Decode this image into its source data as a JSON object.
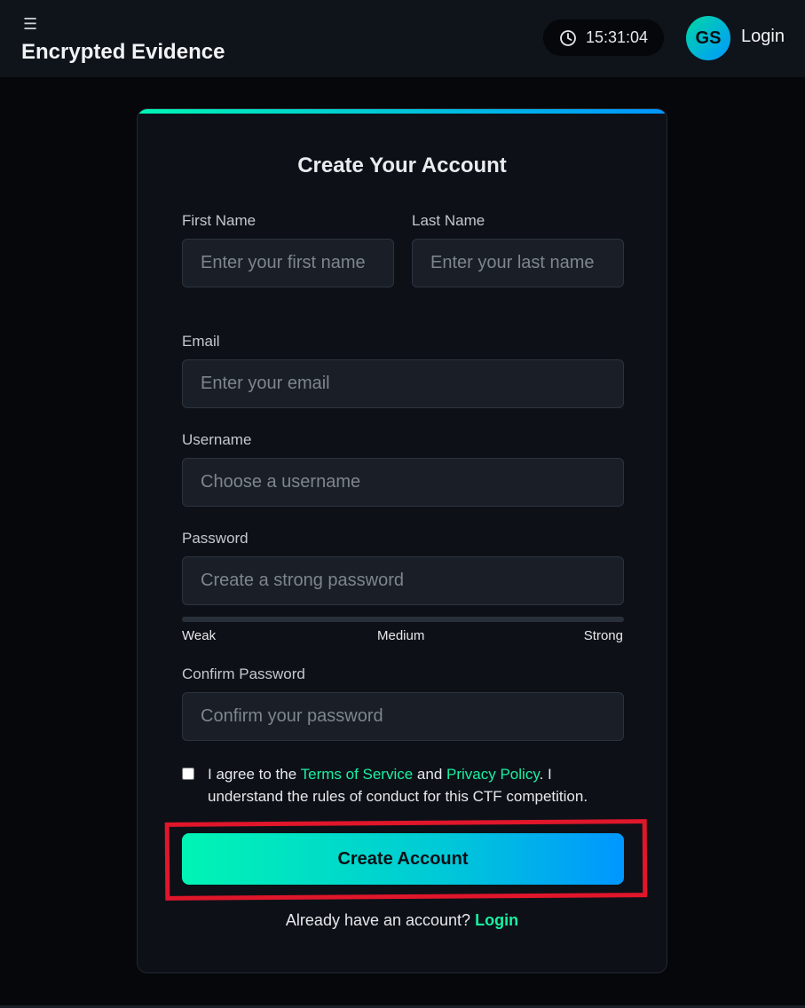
{
  "header": {
    "menu_glyph": "☰",
    "app_title": "Encrypted Evidence",
    "clock_time": "15:31:04",
    "avatar_initials": "GS",
    "login_label": "Login"
  },
  "form": {
    "title": "Create Your Account",
    "first_name": {
      "label": "First Name",
      "placeholder": "Enter your first name",
      "value": ""
    },
    "last_name": {
      "label": "Last Name",
      "placeholder": "Enter your last name",
      "value": ""
    },
    "email": {
      "label": "Email",
      "placeholder": "Enter your email",
      "value": ""
    },
    "username": {
      "label": "Username",
      "placeholder": "Choose a username",
      "value": ""
    },
    "password": {
      "label": "Password",
      "placeholder": "Create a strong password",
      "value": "",
      "strength_fraction": 0,
      "strength_labels": [
        "Weak",
        "Medium",
        "Strong"
      ]
    },
    "confirm_password": {
      "label": "Confirm Password",
      "placeholder": "Confirm your password",
      "value": ""
    },
    "terms": {
      "checked": false,
      "text_prefix": "I agree to the ",
      "terms_link": "Terms of Service",
      "text_and": " and ",
      "privacy_link": "Privacy Policy",
      "text_suffix": ". I understand the rules of conduct for this CTF competition."
    },
    "submit_label": "Create Account",
    "footer_prompt": "Already have an account? ",
    "footer_login_link": "Login"
  },
  "colors": {
    "accent_green": "#19f0a2",
    "accent_blue": "#0096ff",
    "highlight_red": "#e0162b"
  }
}
